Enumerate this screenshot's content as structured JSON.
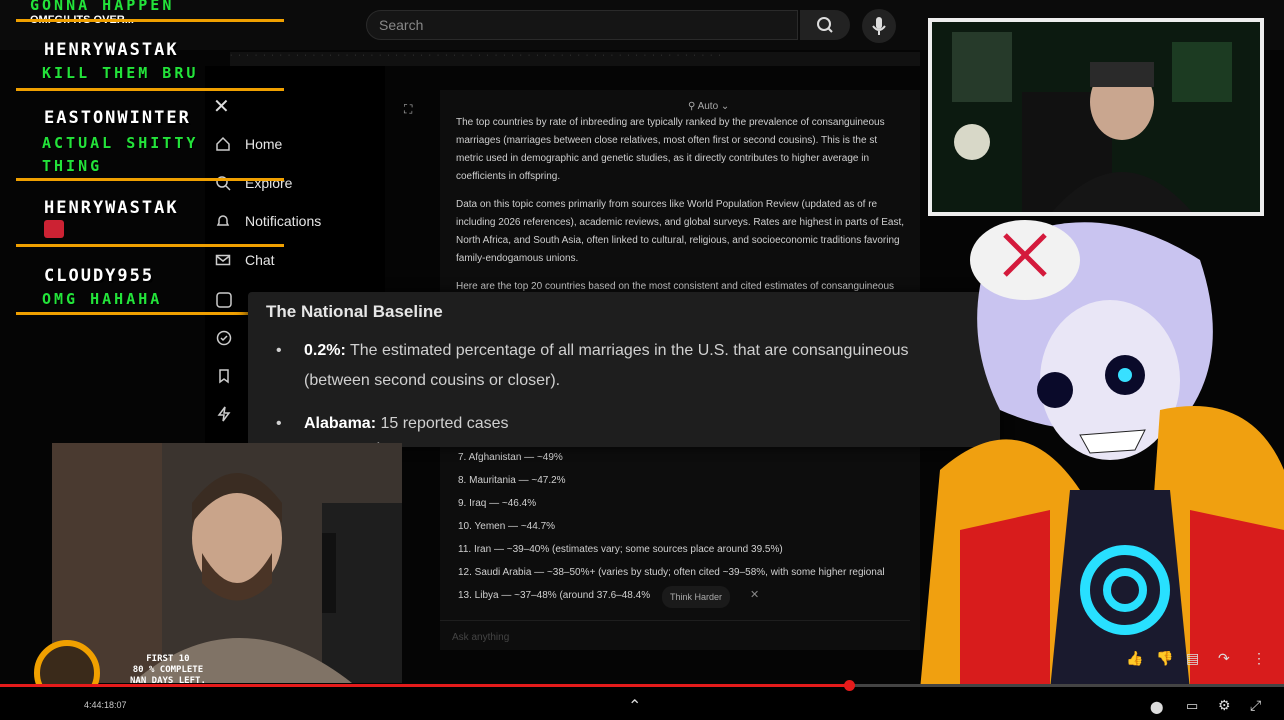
{
  "browser": {
    "search_placeholder": "Search"
  },
  "sidebar": {
    "items": [
      {
        "label": "Home",
        "icon": "home-icon"
      },
      {
        "label": "Explore",
        "icon": "search-icon"
      },
      {
        "label": "Notifications",
        "icon": "bell-icon"
      },
      {
        "label": "Chat",
        "icon": "mail-icon"
      }
    ]
  },
  "grok": {
    "mode": "Auto",
    "para1": "The top countries by rate of inbreeding are typically ranked by the prevalence of consanguineous marriages (marriages between close relatives, most often first or second cousins). This is the st metric used in demographic and genetic studies, as it directly contributes to higher average in coefficients in offspring.",
    "para2": "Data on this topic comes primarily from sources like World Population Review (updated as of re including 2026 references), academic reviews, and global surveys. Rates are highest in parts of East, North Africa, and South Asia, often linked to cultural, religious, and socioeconomic traditions favoring family-endogamous unions.",
    "para3": "Here are the top 20 countries based on the most consistent and cited estimates of consanguineous",
    "list": [
      "7. Afghanistan — ~49%",
      "8. Mauritania — ~47.2%",
      "9. Iraq — ~46.4%",
      "10. Yemen — ~44.7%",
      "11. Iran — ~39–40% (estimates vary; some sources place around 39.5%)",
      "12. Saudi Arabia — ~38–50%+ (varies by study; often cited ~39–58%, with some higher regional",
      "13. Libya — ~37–48% (around 37.6–48.4%"
    ],
    "think_harder": "Think Harder",
    "ask_placeholder": "Ask anything"
  },
  "card": {
    "title": "The National Baseline",
    "bullet1_bold": "0.2%:",
    "bullet1_text": " The estimated percentage of all marriages in the U.S. that are consanguineous",
    "bullet1_cont": "(between second cousins or closer).",
    "bullet2_bold": "Alabama:",
    "bullet2_text": " 15 reported cases"
  },
  "chat": {
    "top_msg": "GONNA HAPPEN",
    "top_sub": "OMFG!! ITS OVER...",
    "messages": [
      {
        "user": "HENRYWASTAK",
        "text": "KILL THEM BRU"
      },
      {
        "user": "EASTONWINTER",
        "text": "ACTUAL SHITTY THING"
      },
      {
        "user": "HENRYWASTAK",
        "text": ""
      },
      {
        "user": "CLOUDY955",
        "text": "OMG HAHAHA"
      }
    ]
  },
  "goal": {
    "line1": "FIRST 10",
    "line2": "80 % COMPLETE",
    "line3": "NAN DAYS LEFT."
  },
  "player": {
    "time": "4:44:18:07",
    "progress_fraction": 0.66
  },
  "colors": {
    "accent_red": "#e51b1b",
    "chat_green": "#23e33a",
    "chat_line": "#f0a000"
  }
}
